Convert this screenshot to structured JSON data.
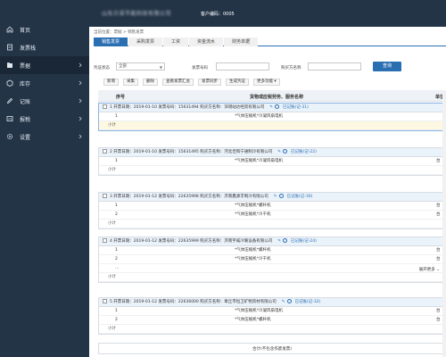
{
  "sidebar": {
    "items": [
      {
        "label": "首页",
        "icon": "home-icon",
        "chevron": false
      },
      {
        "label": "发票栈",
        "icon": "document-icon",
        "chevron": false
      },
      {
        "label": "票据",
        "icon": "folder-icon",
        "chevron": true,
        "active": true
      },
      {
        "label": "库存",
        "icon": "box-icon",
        "chevron": true
      },
      {
        "label": "记账",
        "icon": "pen-icon",
        "chevron": true
      },
      {
        "label": "报税",
        "icon": "report-icon",
        "chevron": true
      },
      {
        "label": "设置",
        "icon": "gear-icon",
        "chevron": true
      }
    ]
  },
  "topbar": {
    "company": "山东贝诺节能科技有限公司",
    "customer_code": "客户编码：0005"
  },
  "breadcrumb": "当前位置：票据 > 销售发票",
  "tabs": [
    "销售发票",
    "采购发票",
    "工资",
    "资金流水",
    "财务单据"
  ],
  "filter": {
    "invoice_type_label": "凭证状态",
    "invoice_type_value": "全部",
    "invoice_no_label": "发票号码",
    "buyer_label": "购买方名称",
    "query_label": "查询"
  },
  "actions": [
    "新增",
    "采集",
    "删除",
    "查看发票汇总",
    "发票同步",
    "生成凭证",
    "更多功能"
  ],
  "table": {
    "col_seq": "序号",
    "col_name": "货物或应税劳务、服务名称",
    "col_unit": "单位",
    "subtotal_label": "小计",
    "more_label": "展开更多",
    "total_label": "合计(不包含作废发票)",
    "groups": [
      {
        "header": "1 开票日期：2019-01-10 发票号码：15631494 购买方名称：深增站达经贸有限公司",
        "status": "已记账(记-31)",
        "rows": [
          {
            "seq": "1",
            "name": "*气体压缩机*冷凝风扇电机",
            "unit": ""
          }
        ]
      },
      {
        "header": "2 开票日期：2019-01-10 发票号码：15631495 购买方名称：河北佳和宁通制冷有限公司",
        "status": "已记账(记-22)",
        "rows": [
          {
            "seq": "1",
            "name": "*气体压缩机*冷凝风扇电机",
            "unit": "台"
          }
        ]
      },
      {
        "header": "3 开票日期：2019-01-12 发票号码：22635998 购买方名称：济南鑫源丰制冷有限公司",
        "status": "已记账(记-30)",
        "rows": [
          {
            "seq": "1",
            "name": "*气体压缩机*螺杆机",
            "unit": "台"
          },
          {
            "seq": "2",
            "name": "*气体压缩机*冷干机",
            "unit": "台"
          }
        ]
      },
      {
        "header": "4 开票日期：2019-01-12 发票号码：22635999 购买方名称：济南宇威冷暖设备有限公司",
        "status": "已记账(记-24)",
        "rows": [
          {
            "seq": "1",
            "name": "*气体压缩机*螺杆机",
            "unit": "台"
          },
          {
            "seq": "2",
            "name": "*气体压缩机*冷干机",
            "unit": "台"
          },
          {
            "seq": "…",
            "name": "",
            "unit": ""
          }
        ]
      },
      {
        "header": "5 开票日期：2019-01-12 发票号码：22636000 购买方名称：章丘市恒卫矿物资材有限公司",
        "status": "已记账(记-32)",
        "rows": [
          {
            "seq": "1",
            "name": "*气体压缩机*冷凝风扇电机",
            "unit": "台"
          },
          {
            "seq": "2",
            "name": "*气体压缩机*螺杆机",
            "unit": "台"
          }
        ]
      }
    ]
  }
}
